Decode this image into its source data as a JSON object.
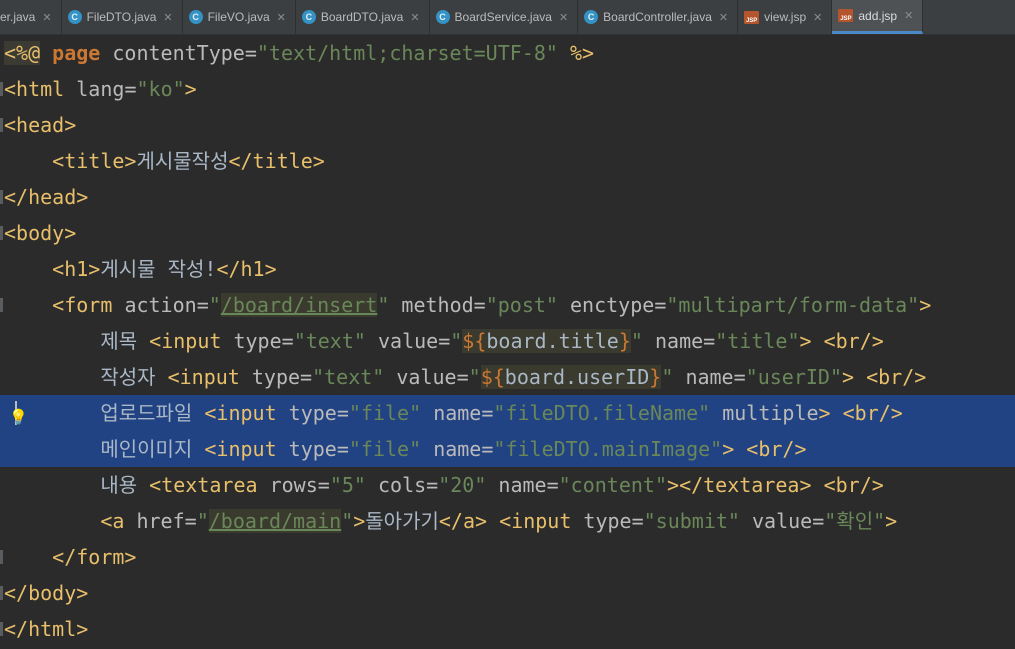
{
  "tabs": [
    {
      "label": "er.java",
      "icon": "java-class-icon",
      "close": "✕",
      "active": false
    },
    {
      "label": "FileDTO.java",
      "icon": "java-class-icon",
      "close": "✕",
      "active": false
    },
    {
      "label": "FileVO.java",
      "icon": "java-class-icon",
      "close": "✕",
      "active": false
    },
    {
      "label": "BoardDTO.java",
      "icon": "java-class-icon",
      "close": "✕",
      "active": false
    },
    {
      "label": "BoardService.java",
      "icon": "java-class-icon",
      "close": "✕",
      "active": false
    },
    {
      "label": "BoardController.java",
      "icon": "java-class-icon",
      "close": "✕",
      "active": false
    },
    {
      "label": "view.jsp",
      "icon": "jsp-file-icon",
      "close": "✕",
      "active": false
    },
    {
      "label": "add.jsp",
      "icon": "jsp-file-icon",
      "close": "✕",
      "active": true
    }
  ],
  "icon_glyphs": {
    "java_class": "C",
    "jsp": "JSP",
    "bulb": "💡"
  },
  "code_lines": [
    "<%@ page contentType=\"text/html;charset=UTF-8\" %>",
    "<html lang=\"ko\">",
    "<head>",
    "    <title>게시물작성</title>",
    "</head>",
    "<body>",
    "    <h1>게시물 작성!</h1>",
    "    <form action=\"/board/insert\" method=\"post\" enctype=\"multipart/form-data\">",
    "        제목 <input type=\"text\" value=\"${board.title}\" name=\"title\"> <br/>",
    "        작성자 <input type=\"text\" value=\"${board.userID}\" name=\"userID\"> <br/>",
    "        업로드파일 <input type=\"file\" name=\"fileDTO.fileName\" multiple> <br/>",
    "        메인이미지 <input type=\"file\" name=\"fileDTO.mainImage\"> <br/>",
    "        내용 <textarea rows=\"5\" cols=\"20\" name=\"content\"></textarea> <br/>",
    "        <a href=\"/board/main\">돌아가기</a> <input type=\"submit\" value=\"확인\">",
    "    </form>",
    "</body>",
    "</html>"
  ],
  "selected_lines": [
    10,
    11
  ],
  "caret_line": 10,
  "colors": {
    "background": "#2b2b2b",
    "selection": "#214283",
    "tag": "#e8bf6a",
    "attribute": "#bababa",
    "string": "#6a8759",
    "keyword": "#cc7832",
    "text": "#a9b7c6"
  }
}
